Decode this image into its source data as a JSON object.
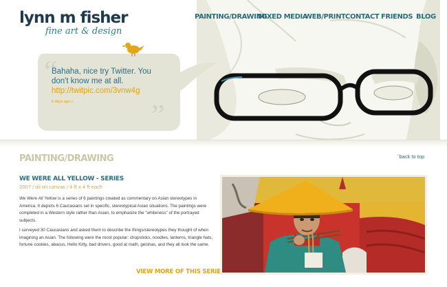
{
  "logo": {
    "name": "lynn m fisher",
    "tagline": "fine art & design"
  },
  "nav": {
    "items": [
      {
        "label": "PAINTING/DRAWING"
      },
      {
        "label": "MIXED MEDIA"
      },
      {
        "label": "WEB/PRINT"
      },
      {
        "label": "CONTACT"
      },
      {
        "label": "FRIENDS"
      },
      {
        "label": "BLOG"
      }
    ]
  },
  "tweet": {
    "text": "Bahaha, nice try Twitter. You don't know me at all.",
    "link": "http://twitpic.com/3vnw4g",
    "time": "6 days ago »"
  },
  "section": {
    "title": "PAINTING/DRAWING",
    "back_to_top": "ˆback to top"
  },
  "series": {
    "title": "WE WERE ALL YELLOW - SERIES",
    "meta": "2007 / oil on canvas / 4 ft x 4 ft each",
    "desc_1_title": "We Were All Yellow",
    "desc_1_rest": " is a series of 6 paintings created as commentary on Asian stereotypes in America. It depicts 6 Caucasians set in specific, stereotypical Asian situations. The paintings were completed in a Western style rather than Asian, to emphasize the \"whiteness\" of the portrayed subjects.",
    "desc_2": "I surveyed 30 Caucasians and asked them to describe the things/stereotypes they thought of when imagining an Asian. The following were the most popular: chopsticks, noodles, lanterns, triangle hats, fortune cookies, abacus, Hello Kitty, bad drivers, good at math, geishas, and they all look the same.",
    "view_more": "VIEW MORE OF THIS SERIES »"
  },
  "colors": {
    "brand_dark": "#1e3a4c",
    "brand_teal": "#2c6b7a",
    "accent_gold": "#e0a30f",
    "muted_title": "#c9c7a6"
  }
}
